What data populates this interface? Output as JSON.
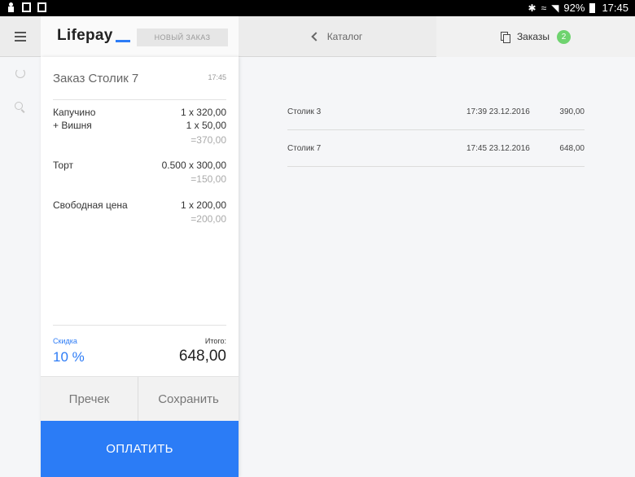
{
  "status_bar": {
    "bluetooth": "✱",
    "signal": "◥",
    "battery": "92%",
    "time": "17:45"
  },
  "header": {
    "brand": "Lifepay",
    "new_order_label": "НОВЫЙ ЗАКАЗ",
    "catalog_label": "Каталог",
    "orders_label": "Заказы",
    "orders_count": "2"
  },
  "order": {
    "title": "Заказ Столик 7",
    "time": "17:45",
    "items": [
      {
        "name": "Капучино",
        "qty": "1 x 320,00",
        "modifier_name": "+ Вишня",
        "modifier_qty": "1 x 50,00",
        "sum": "=370,00"
      },
      {
        "name": "Торт",
        "qty": "0.500 x 300,00",
        "sum": "=150,00"
      },
      {
        "name": "Свободная цена",
        "qty": "1 x 200,00",
        "sum": "=200,00"
      }
    ],
    "discount_label": "Скидка",
    "discount_value": "10 %",
    "total_label": "Итого:",
    "total_value": "648,00",
    "precheck_label": "Пречек",
    "save_label": "Сохранить",
    "pay_label": "ОПЛАТИТЬ"
  },
  "orders_list": [
    {
      "table": "Столик 3",
      "datetime": "17:39 23.12.2016",
      "amount": "390,00"
    },
    {
      "table": "Столик 7",
      "datetime": "17:45 23.12.2016",
      "amount": "648,00"
    }
  ],
  "colors": {
    "accent": "#2b7cf6",
    "badge": "#6fd36f"
  }
}
